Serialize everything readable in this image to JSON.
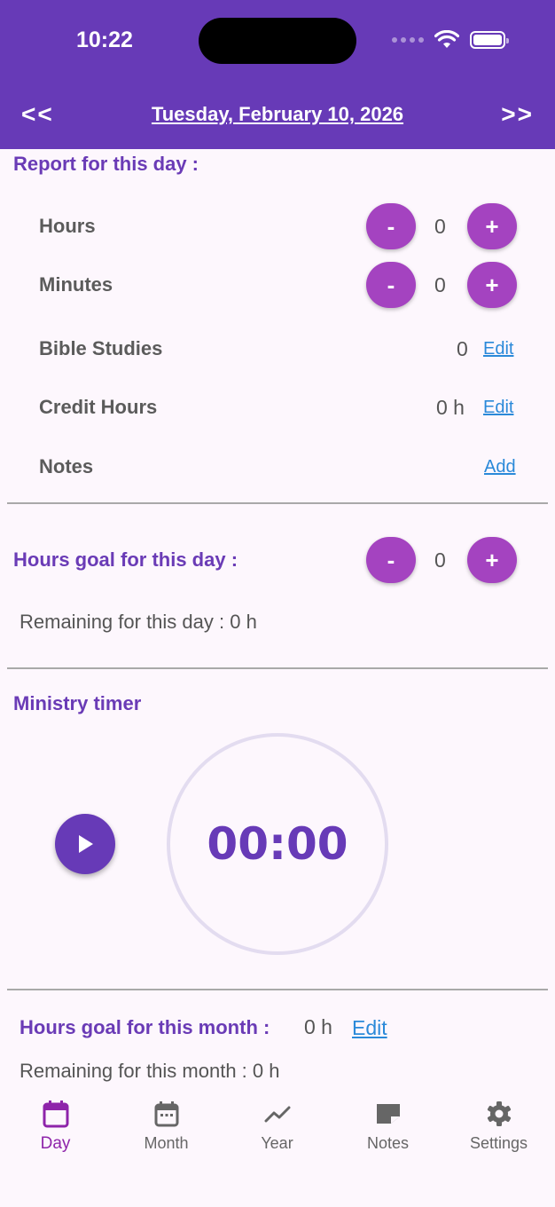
{
  "status_bar": {
    "time": "10:22"
  },
  "header": {
    "prev": "<<",
    "next": ">>",
    "date": "Tuesday, February 10, 2026"
  },
  "report": {
    "title": "Report for this day :",
    "hours": {
      "label": "Hours",
      "value": "0",
      "minus": "-",
      "plus": "+"
    },
    "minutes": {
      "label": "Minutes",
      "value": "0",
      "minus": "-",
      "plus": "+"
    },
    "bible_studies": {
      "label": "Bible Studies",
      "value": "0",
      "action": "Edit"
    },
    "credit_hours": {
      "label": "Credit Hours",
      "value": "0 h",
      "action": "Edit"
    },
    "notes": {
      "label": "Notes",
      "action": "Add"
    }
  },
  "day_goal": {
    "title": "Hours goal for this day :",
    "value": "0",
    "minus": "-",
    "plus": "+",
    "remaining": "Remaining for this day : 0 h"
  },
  "timer": {
    "title": "Ministry timer",
    "display": "00:00"
  },
  "month_goal": {
    "title": "Hours goal for this month :",
    "value": "0 h",
    "action": "Edit",
    "remaining": "Remaining for this month : 0 h"
  },
  "bottom_nav": {
    "tabs": [
      {
        "label": "Day",
        "icon": "calendar-icon",
        "active": true
      },
      {
        "label": "Month",
        "icon": "calendar-month-icon",
        "active": false
      },
      {
        "label": "Year",
        "icon": "trending-icon",
        "active": false
      },
      {
        "label": "Notes",
        "icon": "note-icon",
        "active": false
      },
      {
        "label": "Settings",
        "icon": "gear-icon",
        "active": false
      }
    ]
  },
  "colors": {
    "primary": "#673ab7",
    "accent_button": "#a443c0",
    "link": "#2a89d9",
    "background": "#fdf7fd"
  }
}
